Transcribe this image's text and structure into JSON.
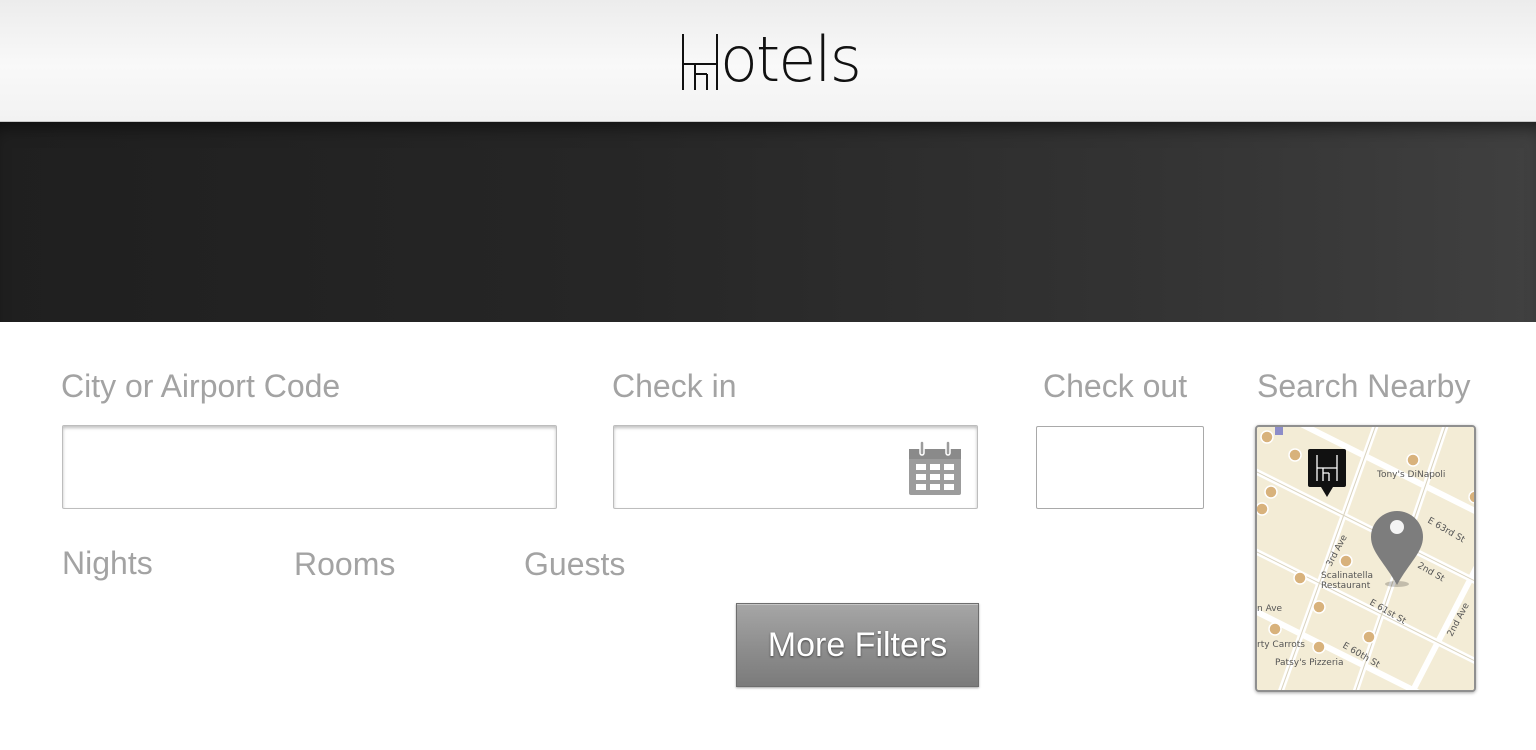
{
  "header": {
    "logo_text": "otels",
    "logo_mark_letter": "H"
  },
  "search": {
    "city_label": "City or Airport Code",
    "city_value": "",
    "checkin_label": "Check in",
    "checkin_value": "",
    "checkout_label": "Check out",
    "checkout_value": "",
    "nearby_label": "Search Nearby",
    "nights_label": "Nights",
    "rooms_label": "Rooms",
    "guests_label": "Guests",
    "more_filters_label": "More Filters"
  },
  "map": {
    "streets": [
      "E 63rd St",
      "2nd St",
      "E 61st St",
      "E 60th St",
      "2nd Ave",
      "3rd Ave",
      "n Ave"
    ],
    "places": [
      "Tony's DiNapoli",
      "Scalinatella",
      "Restaurant",
      "rty Carrots",
      "Patsy's Pizzeria"
    ]
  },
  "icons": {
    "calendar": "calendar-icon",
    "map_pin": "map-pin-icon",
    "hotel_marker": "hotel-marker-icon"
  },
  "colors": {
    "label_gray": "#a3a3a3",
    "hero_dark": "#262626",
    "button_gray": "#8d8d8d",
    "map_land": "#f3ecd6"
  }
}
